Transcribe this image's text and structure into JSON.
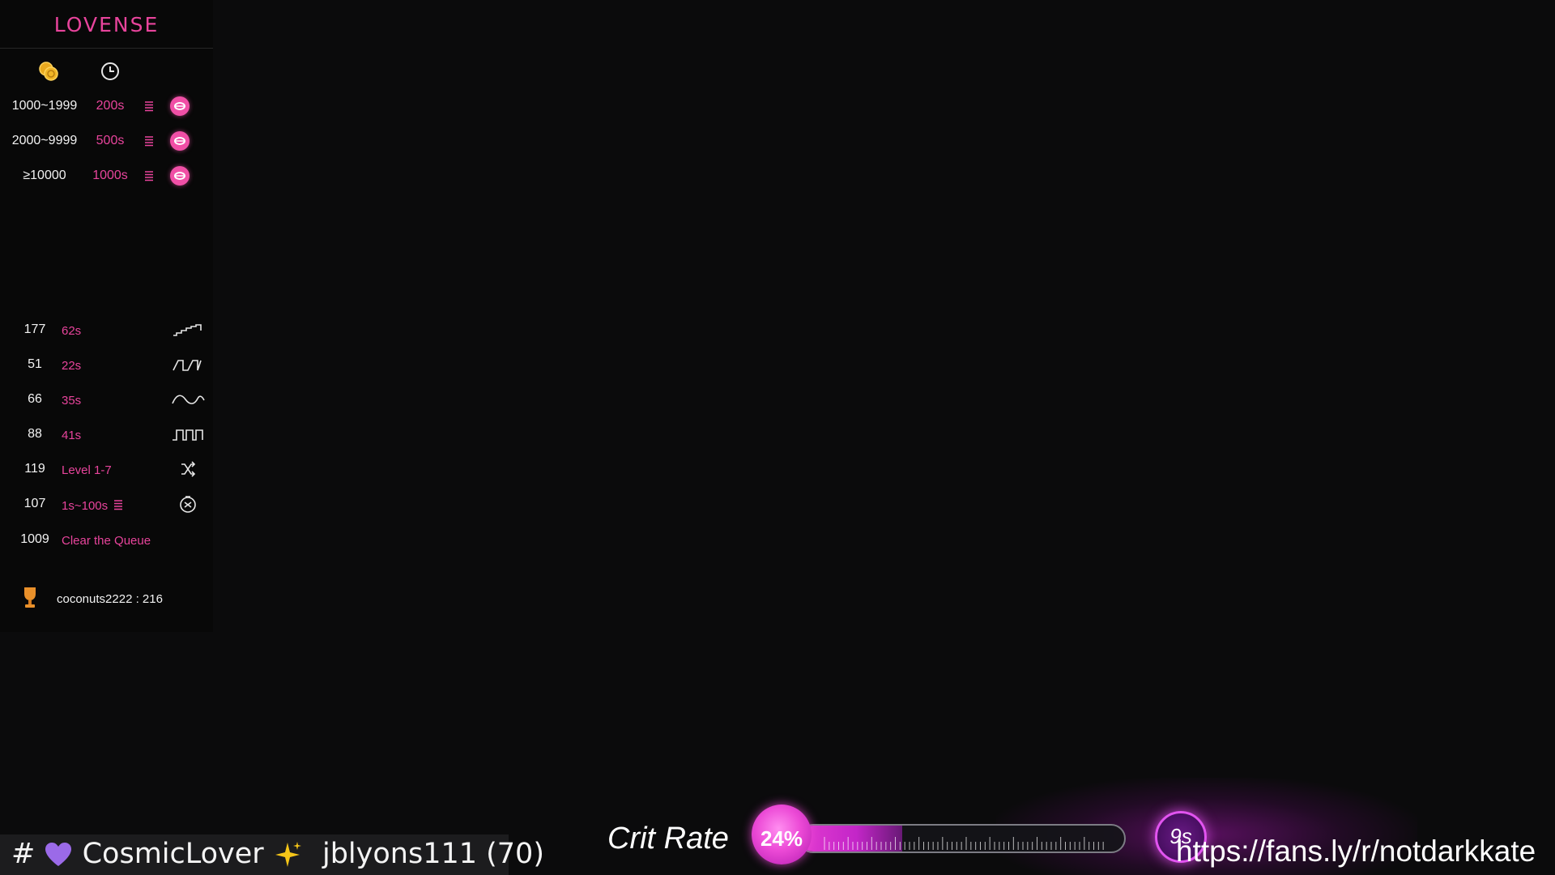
{
  "panel": {
    "logo": "LOVENSE",
    "header_icons": [
      "coins-icon",
      "clock-icon"
    ],
    "tiers": [
      {
        "range": "1000~1999",
        "time": "200s"
      },
      {
        "range": "2000~9999",
        "time": "500s"
      },
      {
        "range": "≥10000",
        "time": "1000s"
      }
    ],
    "patterns": [
      {
        "tokens": "177",
        "desc": "62s",
        "icon": "steps-pattern-icon"
      },
      {
        "tokens": "51",
        "desc": "22s",
        "icon": "pulse-pattern-icon"
      },
      {
        "tokens": "66",
        "desc": "35s",
        "icon": "wave-pattern-icon"
      },
      {
        "tokens": "88",
        "desc": "41s",
        "icon": "square-pattern-icon"
      },
      {
        "tokens": "119",
        "desc": "Level 1-7",
        "icon": "shuffle-icon"
      },
      {
        "tokens": "107",
        "desc": "1s~100s",
        "icon": "timer-cancel-icon"
      },
      {
        "tokens": "1009",
        "desc": "Clear the Queue",
        "icon": ""
      }
    ],
    "leader": "coconuts2222 : 216"
  },
  "ticker": {
    "prefix": "#",
    "name": "CosmicLover",
    "user": "jblyons111 (70)"
  },
  "crit": {
    "label": "Crit Rate",
    "percent_text": "24%",
    "percent": 24,
    "timer": "9s"
  },
  "link": "https://fans.ly/r/notdarkkate",
  "colors": {
    "accent": "#e8449c",
    "glow": "#e254f0"
  }
}
